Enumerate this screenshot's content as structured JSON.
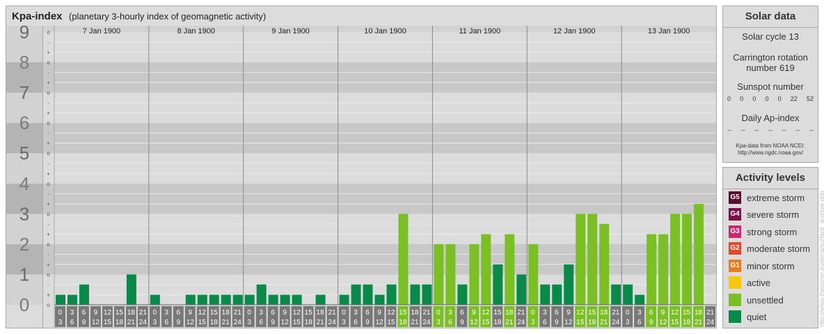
{
  "title": "Kpa-index",
  "subtitle": "(planetary 3-hourly index of geomagnetic activity)",
  "colors": {
    "quiet": "#0a8a48",
    "unsettled": "#7abf24"
  },
  "chart_data": {
    "type": "bar",
    "ylim": [
      0,
      9
    ],
    "y_ticks": [
      "0",
      "1",
      "2",
      "3",
      "4",
      "5",
      "6",
      "7",
      "8",
      "9"
    ],
    "sub_ticks": [
      "-",
      "o",
      "+"
    ],
    "days": [
      "7 Jan 1900",
      "8 Jan 1900",
      "9 Jan 1900",
      "10 Jan 1900",
      "11 Jan 1900",
      "12 Jan 1900",
      "13 Jan 1900"
    ],
    "interval_start": [
      "0",
      "3",
      "6",
      "9",
      "12",
      "15",
      "18",
      "21"
    ],
    "interval_end": [
      "3",
      "6",
      "9",
      "12",
      "15",
      "18",
      "21",
      "24"
    ],
    "values": [
      0.33,
      0.33,
      0.67,
      0,
      0,
      0,
      1,
      0,
      0.33,
      0,
      0,
      0.33,
      0.33,
      0.33,
      0.33,
      0.33,
      0.33,
      0.67,
      0.33,
      0.33,
      0.33,
      0,
      0.33,
      0,
      0.33,
      0.67,
      0.67,
      0.33,
      0.67,
      3,
      0.67,
      0.67,
      2,
      2,
      0.67,
      2,
      2.33,
      1.33,
      2.33,
      1,
      2,
      0.67,
      0.67,
      1.33,
      3,
      3,
      2.67,
      0.67,
      0.67,
      0.33,
      2.33,
      2.33,
      3,
      3,
      3.33,
      0
    ],
    "levels": [
      "quiet",
      "quiet",
      "quiet",
      "quiet",
      "quiet",
      "quiet",
      "quiet",
      "quiet",
      "quiet",
      "quiet",
      "quiet",
      "quiet",
      "quiet",
      "quiet",
      "quiet",
      "quiet",
      "quiet",
      "quiet",
      "quiet",
      "quiet",
      "quiet",
      "quiet",
      "quiet",
      "quiet",
      "quiet",
      "quiet",
      "quiet",
      "quiet",
      "quiet",
      "unsettled",
      "quiet",
      "quiet",
      "unsettled",
      "unsettled",
      "quiet",
      "unsettled",
      "unsettled",
      "quiet",
      "unsettled",
      "quiet",
      "unsettled",
      "quiet",
      "quiet",
      "quiet",
      "unsettled",
      "unsettled",
      "unsettled",
      "quiet",
      "quiet",
      "quiet",
      "unsettled",
      "unsettled",
      "unsettled",
      "unsettled",
      "unsettled",
      "quiet"
    ]
  },
  "solar": {
    "heading": "Solar data",
    "cycle": "Solar cycle 13",
    "carrington_line1": "Carrington rotation",
    "carrington_line2": "number 619",
    "sunspot_label": "Sunspot number",
    "sunspot_values": [
      "0",
      "0",
      "0",
      "0",
      "0",
      "22",
      "52"
    ],
    "ap_label": "Daily Ap-index",
    "ap_values": [
      "--",
      "--",
      "--",
      "--",
      "--",
      "--",
      "--"
    ],
    "credit_line1": "Kpa-data from NOAA NCEI:",
    "credit_line2": "http://www.ngdc.noaa.gov/"
  },
  "activity": {
    "heading": "Activity levels",
    "items": [
      {
        "code": "G5",
        "label": "extreme storm",
        "color": "#5a0a2e"
      },
      {
        "code": "G4",
        "label": "severe storm",
        "color": "#80104a"
      },
      {
        "code": "G3",
        "label": "strong storm",
        "color": "#c8286c"
      },
      {
        "code": "G2",
        "label": "moderate storm",
        "color": "#de4a2a"
      },
      {
        "code": "G1",
        "label": "minor storm",
        "color": "#ec7a1e"
      },
      {
        "code": "",
        "label": "active",
        "color": "#f7c80a"
      },
      {
        "code": "",
        "label": "unsettled",
        "color": "#7abf24"
      },
      {
        "code": "",
        "label": "quiet",
        "color": "#0a8a48"
      }
    ]
  },
  "watermark": "http://www.theusner.eu/terra/surface_archive.php"
}
